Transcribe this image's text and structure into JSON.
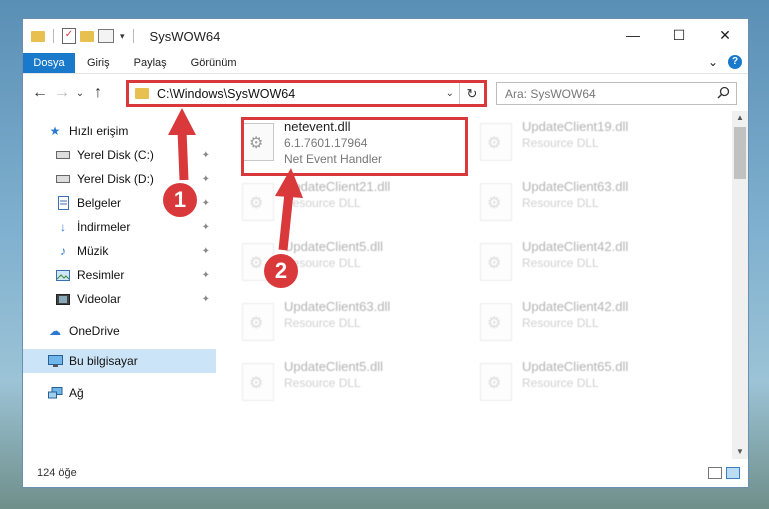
{
  "window": {
    "title": "SysWOW64",
    "minimize": "—",
    "maximize": "☐",
    "close": "✕"
  },
  "ribbon": {
    "tabs": [
      "Dosya",
      "Giriş",
      "Paylaş",
      "Görünüm"
    ],
    "expand": "⌄",
    "help": "?"
  },
  "nav": {
    "back": "←",
    "forward": "→",
    "recent": "⌄",
    "up": "↑",
    "address": "C:\\Windows\\SysWOW64",
    "address_dropdown": "⌄",
    "refresh": "↻",
    "search_placeholder": "Ara: SysWOW64",
    "search_icon": "search-icon"
  },
  "sidebar": {
    "items": [
      {
        "label": "Hızlı erişim",
        "icon": "star-icon",
        "pinned": false
      },
      {
        "label": "Yerel Disk (C:)",
        "icon": "drive-icon",
        "pinned": true
      },
      {
        "label": "Yerel Disk (D:)",
        "icon": "drive-icon",
        "pinned": true
      },
      {
        "label": "Belgeler",
        "icon": "document-icon",
        "pinned": true
      },
      {
        "label": "İndirmeler",
        "icon": "download-icon",
        "pinned": true
      },
      {
        "label": "Müzik",
        "icon": "music-icon",
        "pinned": true
      },
      {
        "label": "Resimler",
        "icon": "pictures-icon",
        "pinned": true
      },
      {
        "label": "Videolar",
        "icon": "video-icon",
        "pinned": true
      },
      {
        "label": "OneDrive",
        "icon": "cloud-icon",
        "pinned": false
      },
      {
        "label": "Bu bilgisayar",
        "icon": "computer-icon",
        "pinned": false
      },
      {
        "label": "Ağ",
        "icon": "network-icon",
        "pinned": false
      }
    ],
    "pin_glyph": "📌"
  },
  "files": [
    {
      "name": "netevent.dll",
      "version": "6.1.7601.17964",
      "desc": "Net Event Handler"
    },
    {
      "name": "UpdateClient19.dll",
      "version": "",
      "desc": "Resource DLL"
    },
    {
      "name": "UpdateClient21.dll",
      "version": "",
      "desc": "Resource DLL"
    },
    {
      "name": "UpdateClient63.dll",
      "version": "",
      "desc": "Resource DLL"
    },
    {
      "name": "UpdateClient5.dll",
      "version": "",
      "desc": "Resource DLL"
    },
    {
      "name": "UpdateClient42.dll",
      "version": "",
      "desc": "Resource DLL"
    },
    {
      "name": "UpdateClient63.dll",
      "version": "",
      "desc": "Resource DLL"
    },
    {
      "name": "UpdateClient42.dll",
      "version": "",
      "desc": "Resource DLL"
    },
    {
      "name": "UpdateClient5.dll",
      "version": "",
      "desc": "Resource DLL"
    },
    {
      "name": "UpdateClient65.dll",
      "version": "",
      "desc": "Resource DLL"
    }
  ],
  "status": {
    "count": "124 öğe"
  },
  "annotations": {
    "step1": "1",
    "step2": "2",
    "color": "#d9393b"
  },
  "colors": {
    "accent": "#1979ca",
    "selection": "#cce4f7"
  }
}
